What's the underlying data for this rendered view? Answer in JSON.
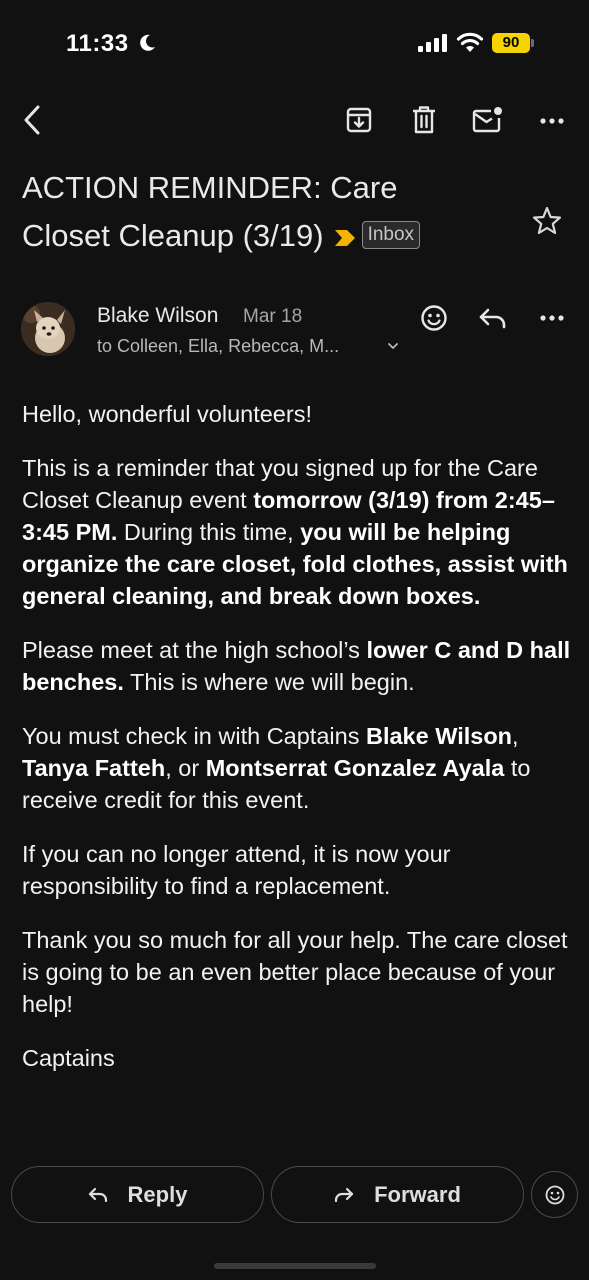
{
  "status_bar": {
    "time": "11:33",
    "battery": "90",
    "icons": [
      "moon-icon",
      "signal-icon",
      "wifi-icon",
      "battery-icon"
    ]
  },
  "toolbar": {
    "icons": [
      "back-icon",
      "archive-icon",
      "trash-icon",
      "mark-unread-icon",
      "more-icon"
    ]
  },
  "email": {
    "subject_line1": "ACTION REMINDER: Care",
    "subject_line2": "Closet Cleanup (3/19)",
    "label": "Inbox",
    "sender": "Blake Wilson",
    "date": "Mar 18",
    "to": "to Colleen, Ella, Rebecca, M...",
    "body": {
      "greeting": "Hello, wonderful volunteers!",
      "p1_a": "This is a reminder that you signed up for the Care Closet Cleanup event ",
      "p1_b": "tomorrow (3/19) from 2:45–3:45 PM.",
      "p1_c": " During this time, ",
      "p1_d": "you will be helping organize the care closet, fold clothes, assist with general cleaning, and break down boxes.",
      "p2_a": "Please meet at the high school’s ",
      "p2_b": "lower C and D hall benches.",
      "p2_c": " This is where we will begin.",
      "p3_a": "You must check in with Captains ",
      "p3_b": "Blake Wilson",
      "p3_c": ", ",
      "p3_d": "Tanya Fatteh",
      "p3_e": ", or ",
      "p3_f": "Montserrat Gonzalez Ayala",
      "p3_g": " to receive credit for this event.",
      "p4": "If you can no longer attend, it is now your responsibility to find a replacement.",
      "p5": "Thank you so much for all your help. The care closet is going to be an even better place because of your help!",
      "signoff": "Captains"
    }
  },
  "actions": {
    "reply": "Reply",
    "forward": "Forward"
  },
  "colors": {
    "background": "#111111",
    "battery": "#f5d400",
    "important_marker": "#f2b400"
  }
}
